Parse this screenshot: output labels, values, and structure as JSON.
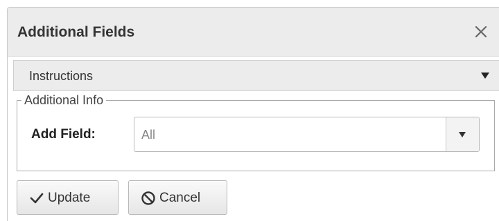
{
  "dialog": {
    "title": "Additional Fields",
    "close_icon": "close-icon"
  },
  "accordion": {
    "label": "Instructions",
    "icon": "caret-down-icon"
  },
  "additional_info": {
    "legend": "Additional Info",
    "field_label": "Add Field:",
    "field_value": "All",
    "dropdown_icon": "caret-down-icon"
  },
  "buttons": {
    "update": {
      "label": "Update",
      "icon": "checkmark-icon"
    },
    "cancel": {
      "label": "Cancel",
      "icon": "ban-icon"
    }
  },
  "colors": {
    "header_bg": "#ececec",
    "border": "#b8b8b8",
    "text": "#333333",
    "placeholder_text": "#888888"
  }
}
